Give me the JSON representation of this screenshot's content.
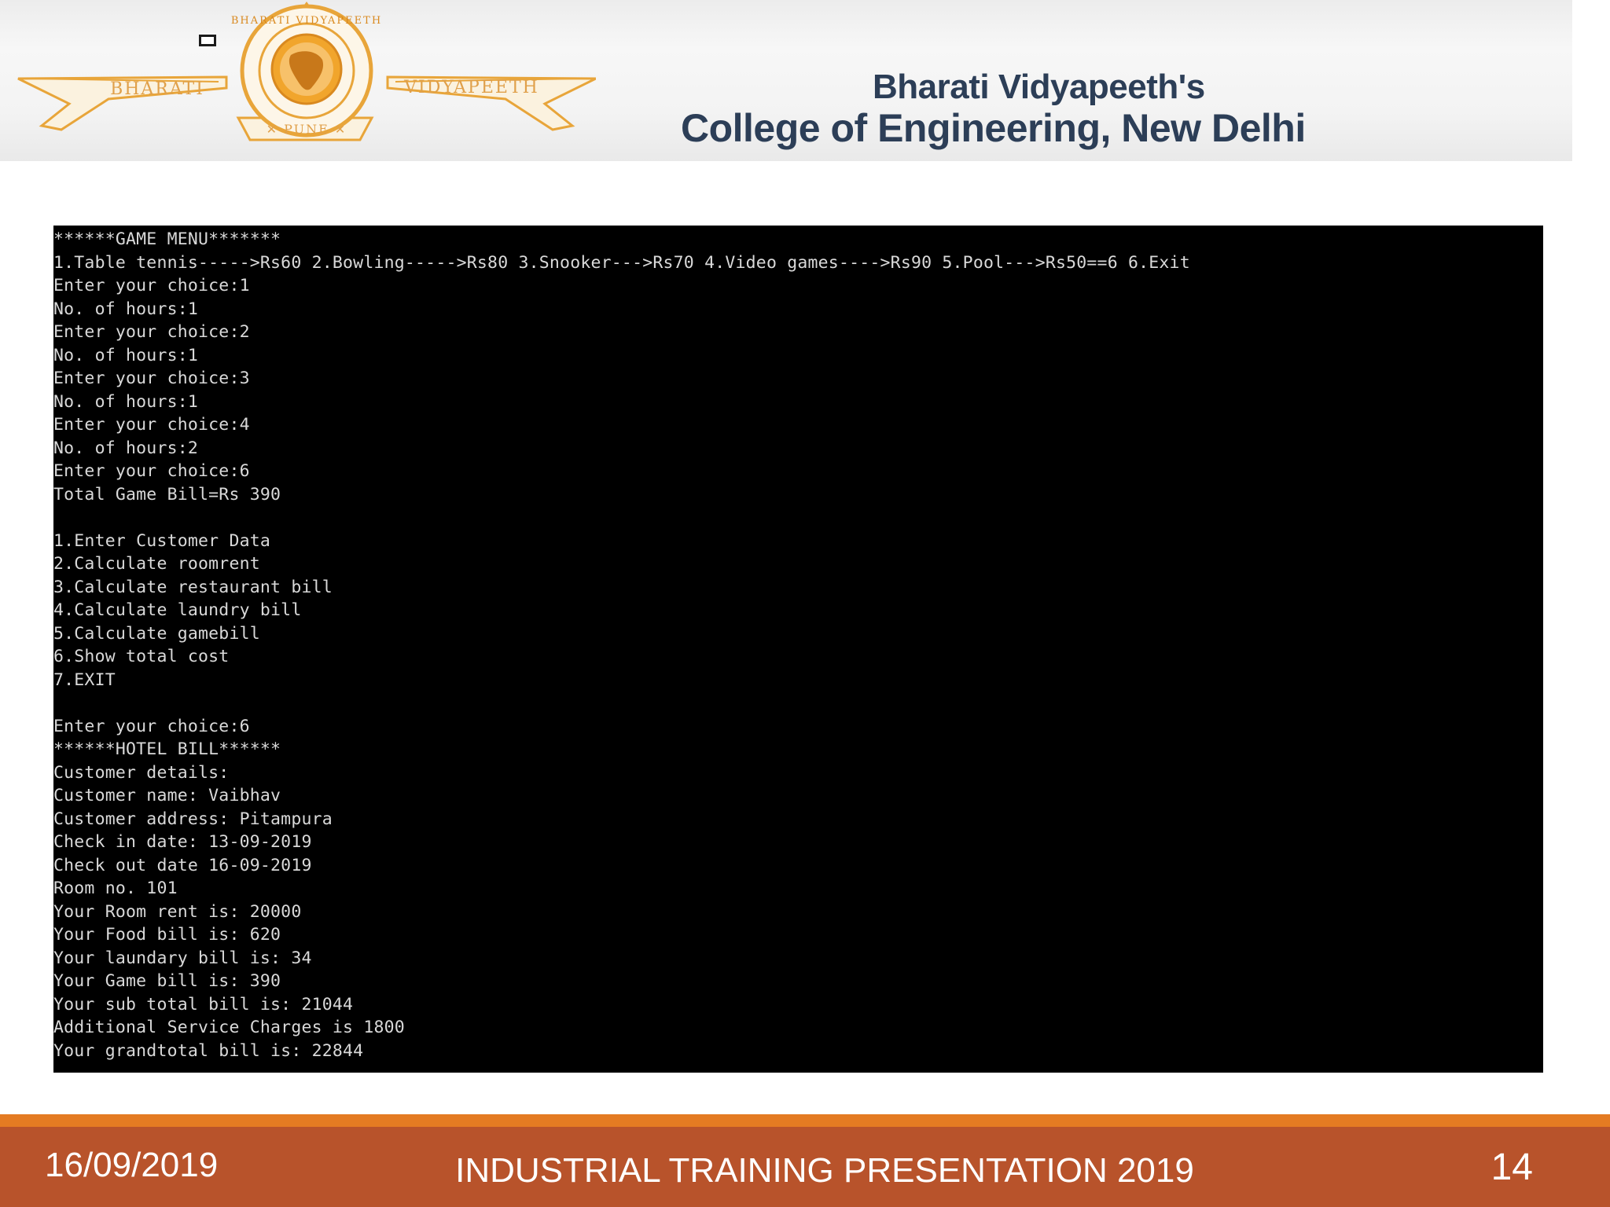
{
  "header": {
    "logo": {
      "left_word": "BHARATI",
      "right_word": "VIDYAPEETH",
      "bottom_word": "PUNE",
      "ring_text": "BHARATI VIDYAPEETH PUNE"
    },
    "college_line_1": "Bharati Vidyapeeth's",
    "college_line_2": "College of Engineering, New Delhi"
  },
  "console": {
    "lines": [
      "******GAME MENU*******",
      "1.Table tennis----->Rs60 2.Bowling----->Rs80 3.Snooker--->Rs70 4.Video games---->Rs90 5.Pool--->Rs50==6 6.Exit",
      "Enter your choice:1",
      "No. of hours:1",
      "Enter your choice:2",
      "No. of hours:1",
      "Enter your choice:3",
      "No. of hours:1",
      "Enter your choice:4",
      "No. of hours:2",
      "Enter your choice:6",
      "Total Game Bill=Rs 390",
      "",
      "1.Enter Customer Data",
      "2.Calculate roomrent",
      "3.Calculate restaurant bill",
      "4.Calculate laundry bill",
      "5.Calculate gamebill",
      "6.Show total cost",
      "7.EXIT",
      "",
      "Enter your choice:6",
      "******HOTEL BILL******",
      "Customer details:",
      "Customer name: Vaibhav",
      "Customer address: Pitampura",
      "Check in date: 13-09-2019",
      "Check out date 16-09-2019",
      "Room no. 101",
      "Your Room rent is: 20000",
      "Your Food bill is: 620",
      "Your laundary bill is: 34",
      "Your Game bill is: 390",
      "Your sub total bill is: 21044",
      "Additional Service Charges is 1800",
      "Your grandtotal bill is: 22844"
    ]
  },
  "footer": {
    "date": "16/09/2019",
    "title": "INDUSTRIAL TRAINING PRESENTATION 2019",
    "page_number": "14"
  },
  "colors": {
    "footer_bar": "#b8532b",
    "footer_accent": "#e47b22",
    "college_text": "#2c3e57",
    "logo_gold": "#e8a53a",
    "console_bg": "#000000",
    "console_text": "#d9d9d9"
  }
}
